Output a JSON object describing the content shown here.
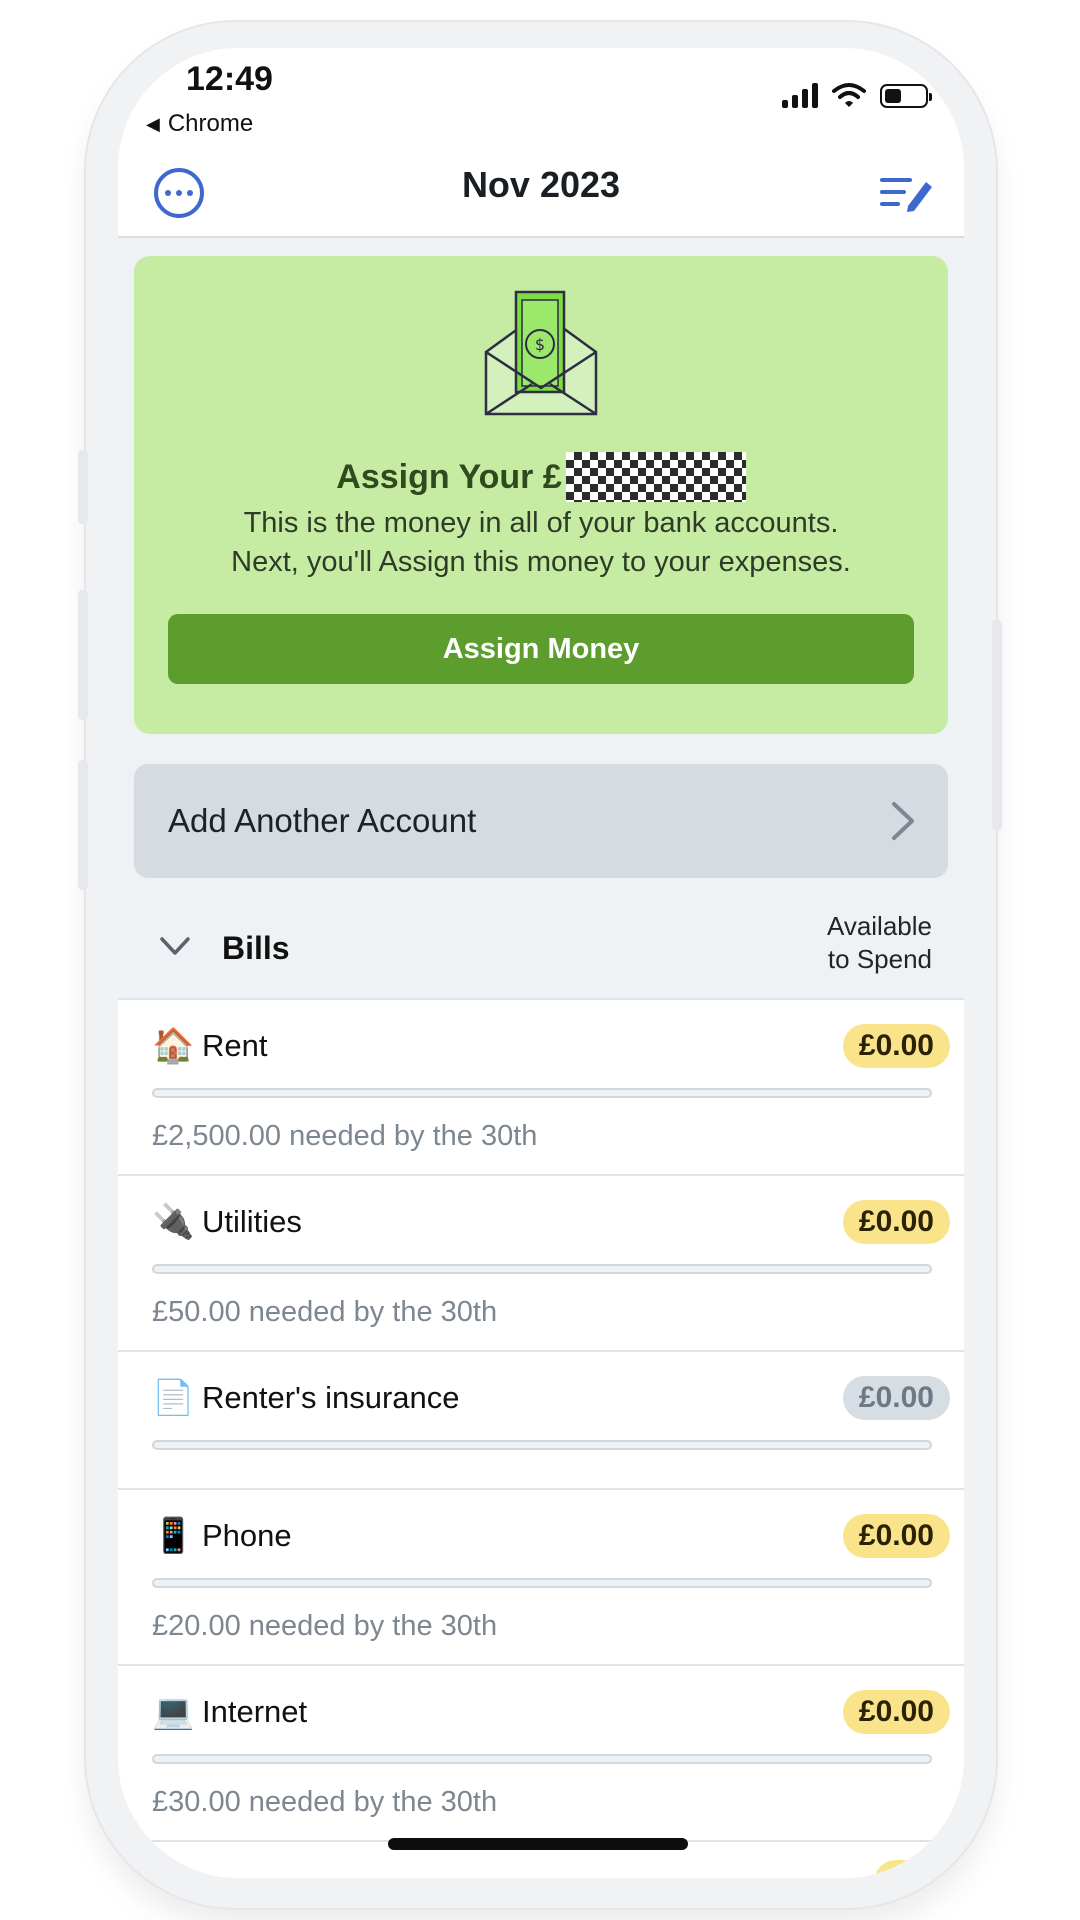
{
  "status_bar": {
    "time": "12:49",
    "back_app": "Chrome"
  },
  "header": {
    "title": "Nov 2023"
  },
  "assign_card": {
    "title": "Assign Your £",
    "description_line1": "This is the money in all of your bank accounts.",
    "description_line2": "Next, you'll Assign this money to your expenses.",
    "button_label": "Assign Money"
  },
  "add_account": {
    "label": "Add Another Account"
  },
  "group": {
    "name": "Bills",
    "column_line1": "Available",
    "column_line2": "to Spend"
  },
  "bills": [
    {
      "icon": "house-icon",
      "emoji": "🏠",
      "name": "Rent",
      "available": "£0.00",
      "pill": "yellow",
      "needed": "£2,500.00 needed by the 30th"
    },
    {
      "icon": "plug-icon",
      "emoji": "🔌",
      "name": "Utilities",
      "available": "£0.00",
      "pill": "yellow",
      "needed": "£50.00 needed by the 30th"
    },
    {
      "icon": "document-icon",
      "emoji": "📄",
      "name": "Renter's insurance",
      "available": "£0.00",
      "pill": "grey",
      "needed": ""
    },
    {
      "icon": "phone-icon",
      "emoji": "📱",
      "name": "Phone",
      "available": "£0.00",
      "pill": "yellow",
      "needed": "£20.00 needed by the 30th"
    },
    {
      "icon": "laptop-icon",
      "emoji": "💻",
      "name": "Internet",
      "available": "£0.00",
      "pill": "yellow",
      "needed": "£30.00 needed by the 30th"
    }
  ],
  "colors": {
    "accent": "#3e67cf",
    "assign_card_bg": "#c6eca3",
    "assign_button": "#5c9d2e",
    "pill_yellow": "#fae48b",
    "pill_grey": "#d6dde3"
  }
}
